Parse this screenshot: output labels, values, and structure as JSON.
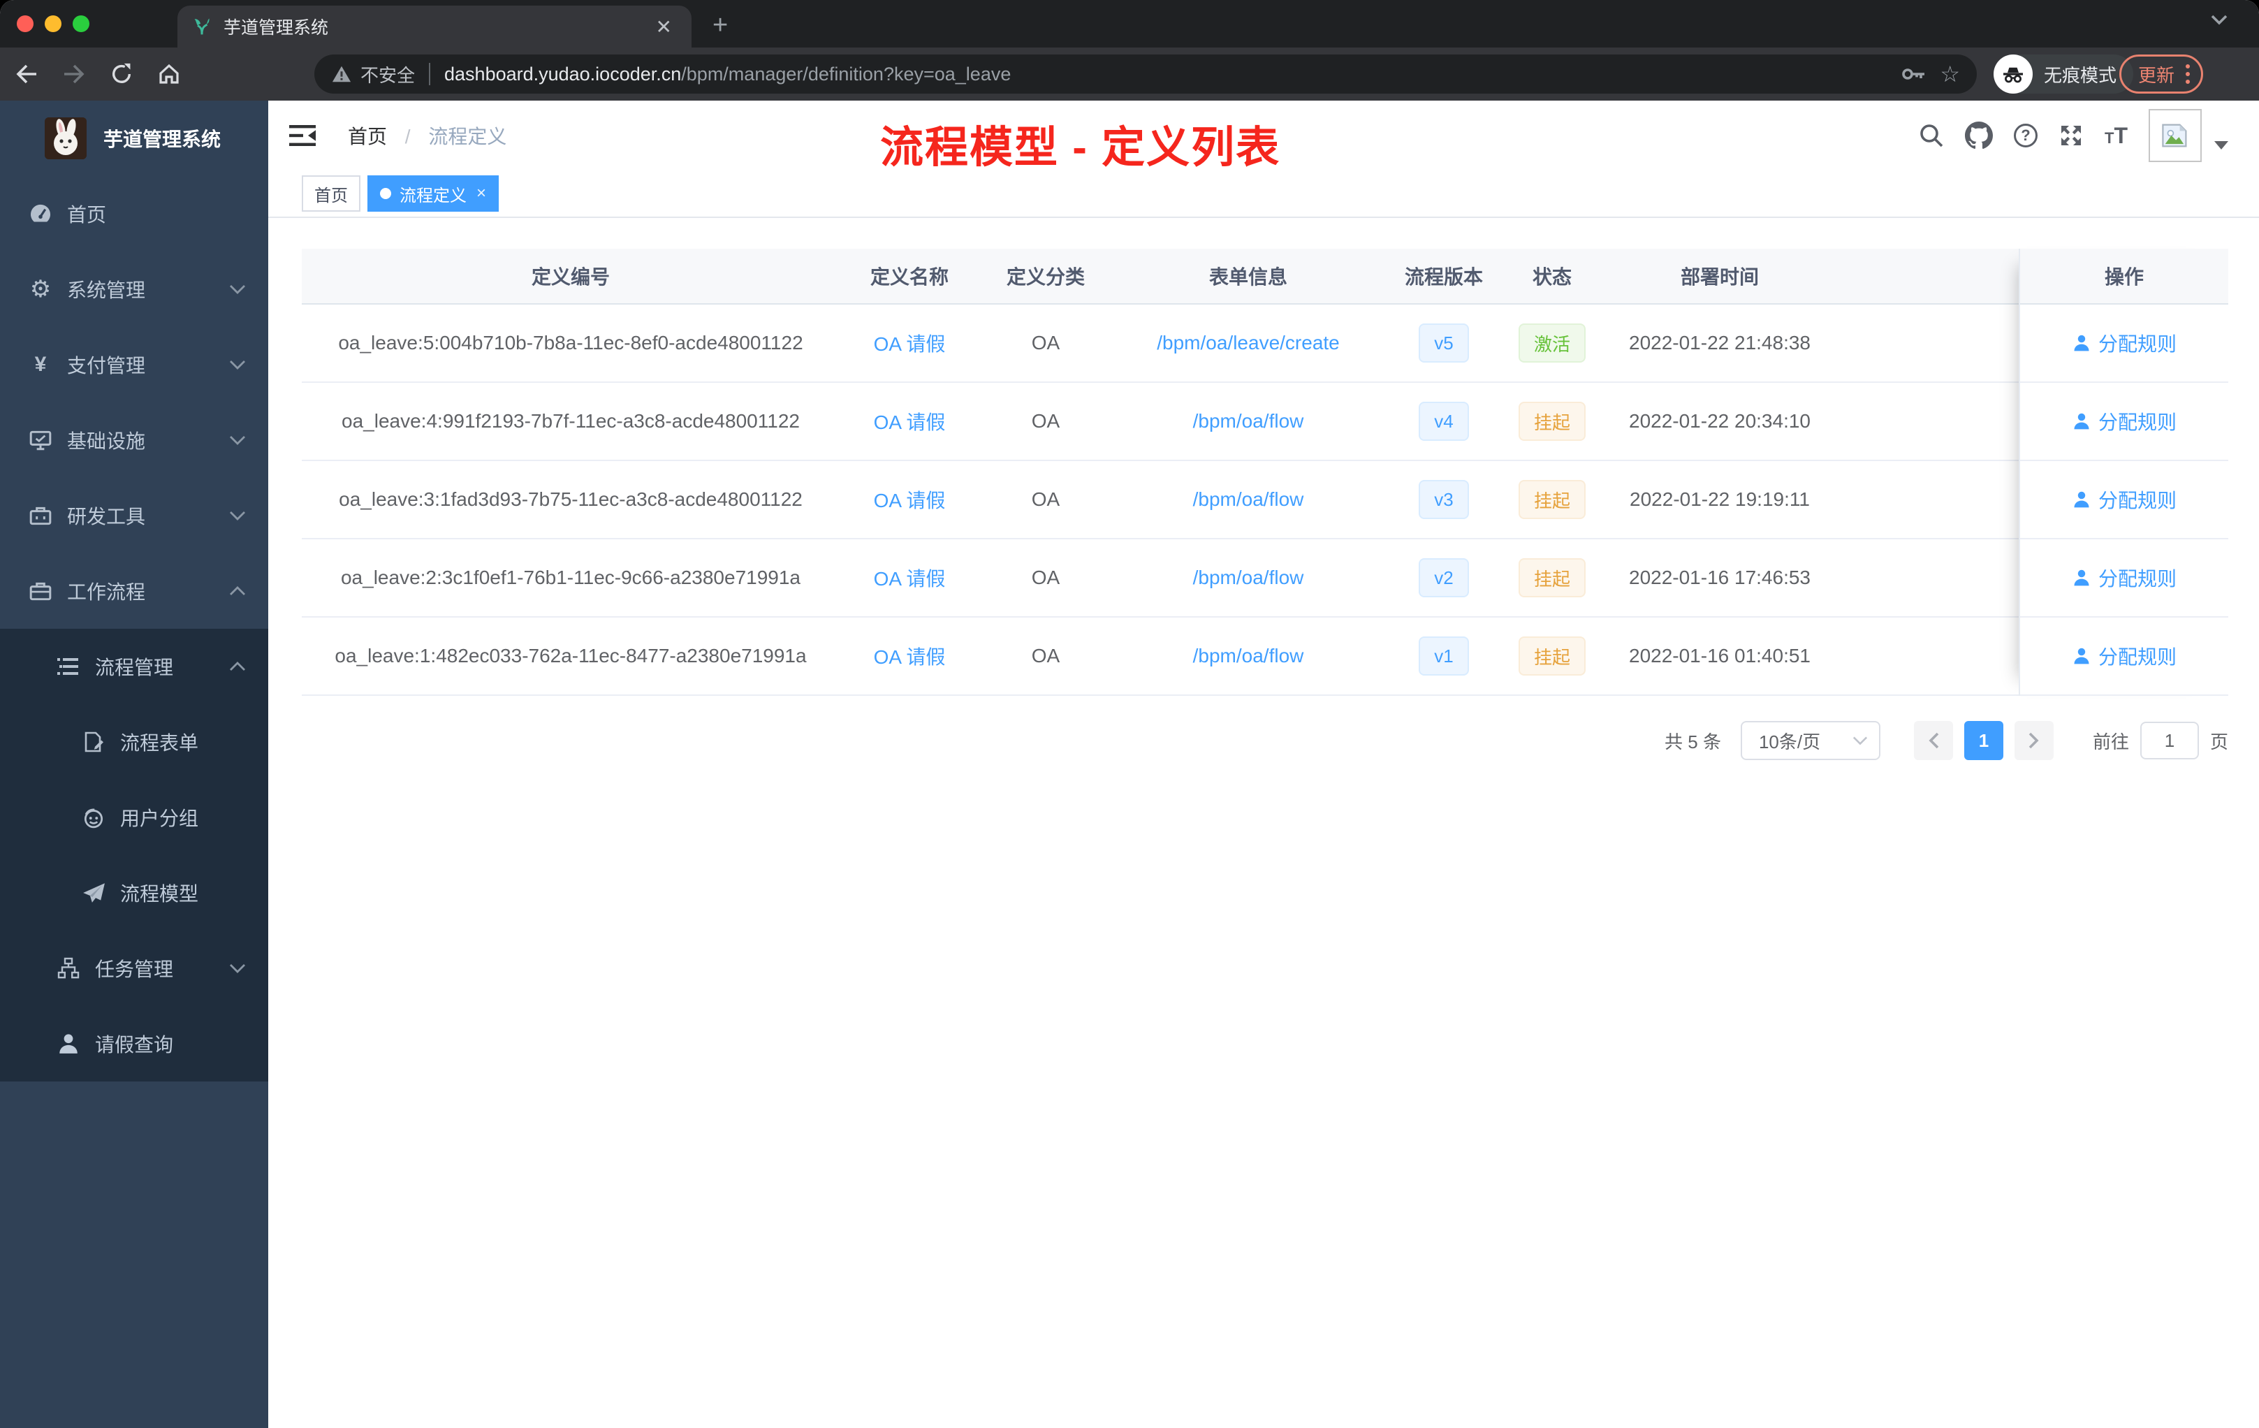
{
  "browser": {
    "tab_title": "芋道管理系统",
    "security_label": "不安全",
    "url_domain": "dashboard.yudao.iocoder.cn",
    "url_path": "/bpm/manager/definition?key=oa_leave",
    "incognito_label": "无痕模式",
    "update_label": "更新"
  },
  "sidebar": {
    "app_title": "芋道管理系统",
    "items": [
      {
        "label": "首页",
        "icon": "dashboard-icon"
      },
      {
        "label": "系统管理",
        "icon": "gear-icon"
      },
      {
        "label": "支付管理",
        "icon": "yen-icon"
      },
      {
        "label": "基础设施",
        "icon": "monitor-icon"
      },
      {
        "label": "研发工具",
        "icon": "toolbox-icon"
      },
      {
        "label": "工作流程",
        "icon": "briefcase-icon"
      }
    ],
    "sub": [
      {
        "label": "流程管理",
        "icon": "list-icon"
      },
      {
        "label": "流程表单",
        "icon": "form-icon"
      },
      {
        "label": "用户分组",
        "icon": "group-icon"
      },
      {
        "label": "流程模型",
        "icon": "paper-plane-icon"
      },
      {
        "label": "任务管理",
        "icon": "tree-icon"
      },
      {
        "label": "请假查询",
        "icon": "person-icon"
      }
    ]
  },
  "navbar": {
    "breadcrumb_home": "首页",
    "breadcrumb_sep": "/",
    "breadcrumb_current": "流程定义"
  },
  "tags": {
    "home": "首页",
    "active": "流程定义"
  },
  "annotation": "流程模型 - 定义列表",
  "table": {
    "headers": {
      "id": "定义编号",
      "name": "定义名称",
      "category": "定义分类",
      "form": "表单信息",
      "version": "流程版本",
      "status": "状态",
      "deploy": "部署时间",
      "action": "操作"
    },
    "rows": [
      {
        "id": "oa_leave:5:004b710b-7b8a-11ec-8ef0-acde48001122",
        "name": "OA 请假",
        "category": "OA",
        "form": "/bpm/oa/leave/create",
        "version": "v5",
        "status": "激活",
        "status_type": "success",
        "deploy": "2022-01-22 21:48:38",
        "action": "分配规则"
      },
      {
        "id": "oa_leave:4:991f2193-7b7f-11ec-a3c8-acde48001122",
        "name": "OA 请假",
        "category": "OA",
        "form": "/bpm/oa/flow",
        "version": "v4",
        "status": "挂起",
        "status_type": "warning",
        "deploy": "2022-01-22 20:34:10",
        "action": "分配规则"
      },
      {
        "id": "oa_leave:3:1fad3d93-7b75-11ec-a3c8-acde48001122",
        "name": "OA 请假",
        "category": "OA",
        "form": "/bpm/oa/flow",
        "version": "v3",
        "status": "挂起",
        "status_type": "warning",
        "deploy": "2022-01-22 19:19:11",
        "action": "分配规则"
      },
      {
        "id": "oa_leave:2:3c1f0ef1-76b1-11ec-9c66-a2380e71991a",
        "name": "OA 请假",
        "category": "OA",
        "form": "/bpm/oa/flow",
        "version": "v2",
        "status": "挂起",
        "status_type": "warning",
        "deploy": "2022-01-16 17:46:53",
        "action": "分配规则"
      },
      {
        "id": "oa_leave:1:482ec033-762a-11ec-8477-a2380e71991a",
        "name": "OA 请假",
        "category": "OA",
        "form": "/bpm/oa/flow",
        "version": "v1",
        "status": "挂起",
        "status_type": "warning",
        "deploy": "2022-01-16 01:40:51",
        "action": "分配规则"
      }
    ]
  },
  "pagination": {
    "total": "共 5 条",
    "page_size": "10条/页",
    "current": "1",
    "goto_label": "前往",
    "goto_value": "1",
    "unit_label": "页"
  },
  "colors": {
    "accent": "#409eff",
    "success": "#67c23a",
    "warning": "#e6a23c",
    "annotation_red": "#f5261d"
  }
}
